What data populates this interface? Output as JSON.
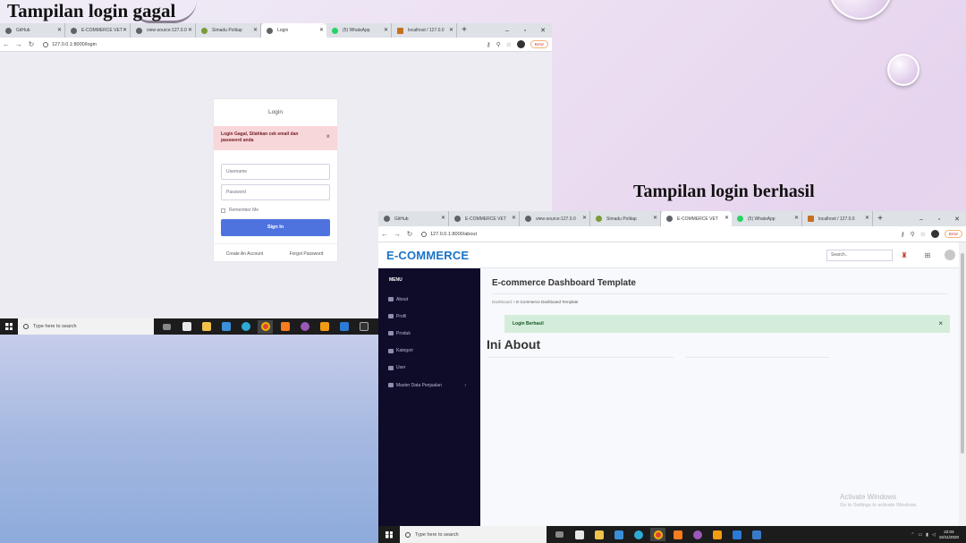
{
  "captions": {
    "fail": "Tampilan login gagal",
    "success": "Tampilan login berhasil"
  },
  "left": {
    "tabs": [
      {
        "label": "GitHub",
        "icon": "github-icon"
      },
      {
        "label": "E-COMMERCE VET",
        "icon": "github-icon"
      },
      {
        "label": "view-source:127.0.0",
        "icon": "globe-icon"
      },
      {
        "label": "Simadu Politap",
        "icon": "simadu-icon"
      },
      {
        "label": "Login",
        "icon": "globe-icon",
        "active": true
      },
      {
        "label": "(5) WhatsApp",
        "icon": "whatsapp-icon"
      },
      {
        "label": "localhost / 127.0.0",
        "icon": "phpmyadmin-icon"
      }
    ],
    "url": "127.0.0.1:8000/login",
    "error_pill": "Error",
    "login": {
      "title": "Login",
      "alert": "Login Gagal, Silahkan cek email dan password anda",
      "username_placeholder": "Username",
      "password_placeholder": "Password",
      "remember": "Remember Me",
      "signin": "Sign In",
      "create": "Create An Account",
      "forgot": "Forgot Password"
    },
    "taskbar_search": "Type here to search"
  },
  "right": {
    "tabs": [
      {
        "label": "GitHub",
        "icon": "github-icon"
      },
      {
        "label": "E-COMMERCE VET",
        "icon": "github-icon"
      },
      {
        "label": "view-source:127.0.0",
        "icon": "globe-icon"
      },
      {
        "label": "Simadu Politap",
        "icon": "simadu-icon"
      },
      {
        "label": "E-COMMERCE VET",
        "icon": "globe-icon",
        "active": true
      },
      {
        "label": "(5) WhatsApp",
        "icon": "whatsapp-icon"
      },
      {
        "label": "localhost / 127.0.0",
        "icon": "phpmyadmin-icon"
      }
    ],
    "url": "127.0.0.1:8000/about",
    "error_pill": "Error",
    "brand": "E-COMMERCE",
    "search_placeholder": "Search..",
    "menu_heading": "MENU",
    "menu": [
      "About",
      "Profil",
      "Produk",
      "Kategori",
      "User",
      "Master Data Penjualan"
    ],
    "page_title": "E-commerce Dashboard Template",
    "breadcrumb": {
      "root": "Dashboard",
      "sep": ">",
      "current": "E-Commerce Dashboard Template"
    },
    "alert": "Login Berhasil",
    "heading": "Ini About",
    "watermark": {
      "line1": "Activate Windows",
      "line2": "Go to Settings to activate Windows."
    },
    "taskbar_search": "Type here to search",
    "clock": {
      "time": "22:03",
      "date": "15/11/2020"
    }
  }
}
